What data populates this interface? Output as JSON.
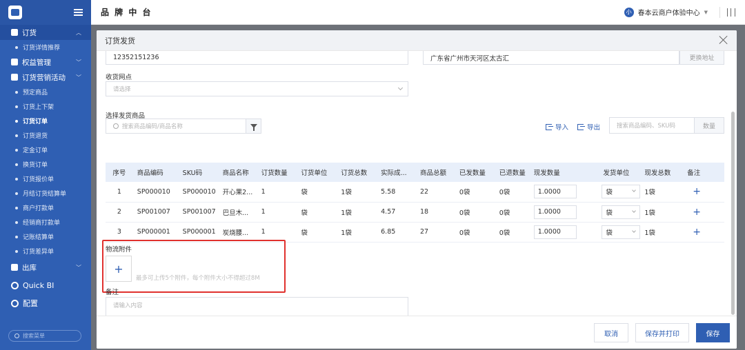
{
  "app": {
    "brand": "品 牌 中 台"
  },
  "topbar": {
    "org_avatar": "小",
    "org_name": "春本云商户体验中心"
  },
  "sidebar": {
    "section_order": "订货",
    "items_order": [
      "订货详情推荐"
    ],
    "section_rights": "权益管理",
    "section_promo": "订货营销活动",
    "items_promo": [
      "预定商品",
      "订货上下架",
      "订货订单",
      "订货退货",
      "定金订单",
      "换货订单",
      "订货报价单",
      "月结订货结算单",
      "商户打款单",
      "经销商打款单",
      "记账结算单",
      "订货差异单"
    ],
    "section_out": "出库",
    "quick_bi": "Quick BI",
    "config": "配置",
    "search_placeholder": "搜索菜单"
  },
  "modal": {
    "title": "订货发货",
    "phone": "12352151236",
    "address": "广东省广州市天河区太古汇",
    "change_address": "更换地址",
    "receive_point_label": "收货网点",
    "receive_point_placeholder": "请选择",
    "select_goods_label": "选择发货商品",
    "goods_search_placeholder": "搜索商品编码/商品名称",
    "import_label": "导入",
    "export_label": "导出",
    "sku_search_placeholder": "搜索商品编码、SKU码",
    "quantity_button": "数量",
    "columns": [
      "序号",
      "商品编码",
      "SKU码",
      "商品名称",
      "订货数量",
      "订货单位",
      "订货总数",
      "实际成...",
      "商品总额",
      "已发数量",
      "已退数量",
      "现发数量",
      "发货单位",
      "现发总数",
      "备注"
    ],
    "rows": [
      {
        "no": "1",
        "code": "SP000010",
        "sku": "SP000010",
        "name": "开心果2...",
        "qty": "1",
        "unit": "袋",
        "total": "1袋",
        "cost": "5.58",
        "amount": "22",
        "shipped": "0袋",
        "returned": "0袋",
        "now_qty": "1.0000",
        "ship_unit": "袋",
        "now_total": "1袋"
      },
      {
        "no": "2",
        "code": "SP001007",
        "sku": "SP001007",
        "name": "巴旦木...",
        "qty": "1",
        "unit": "袋",
        "total": "1袋",
        "cost": "4.57",
        "amount": "18",
        "shipped": "0袋",
        "returned": "0袋",
        "now_qty": "1.0000",
        "ship_unit": "袋",
        "now_total": "1袋"
      },
      {
        "no": "3",
        "code": "SP000001",
        "sku": "SP000001",
        "name": "炭烧腰...",
        "qty": "1",
        "unit": "袋",
        "total": "1袋",
        "cost": "6.85",
        "amount": "27",
        "shipped": "0袋",
        "returned": "0袋",
        "now_qty": "1.0000",
        "ship_unit": "袋",
        "now_total": "1袋"
      }
    ],
    "attachment_label": "物流附件",
    "attachment_hint": "最多可上传5个附件，每个附件大小不得超过8M",
    "remark_label": "备注",
    "remark_placeholder": "请输入内容",
    "cancel": "取消",
    "save_print": "保存并打印",
    "save": "保存"
  }
}
